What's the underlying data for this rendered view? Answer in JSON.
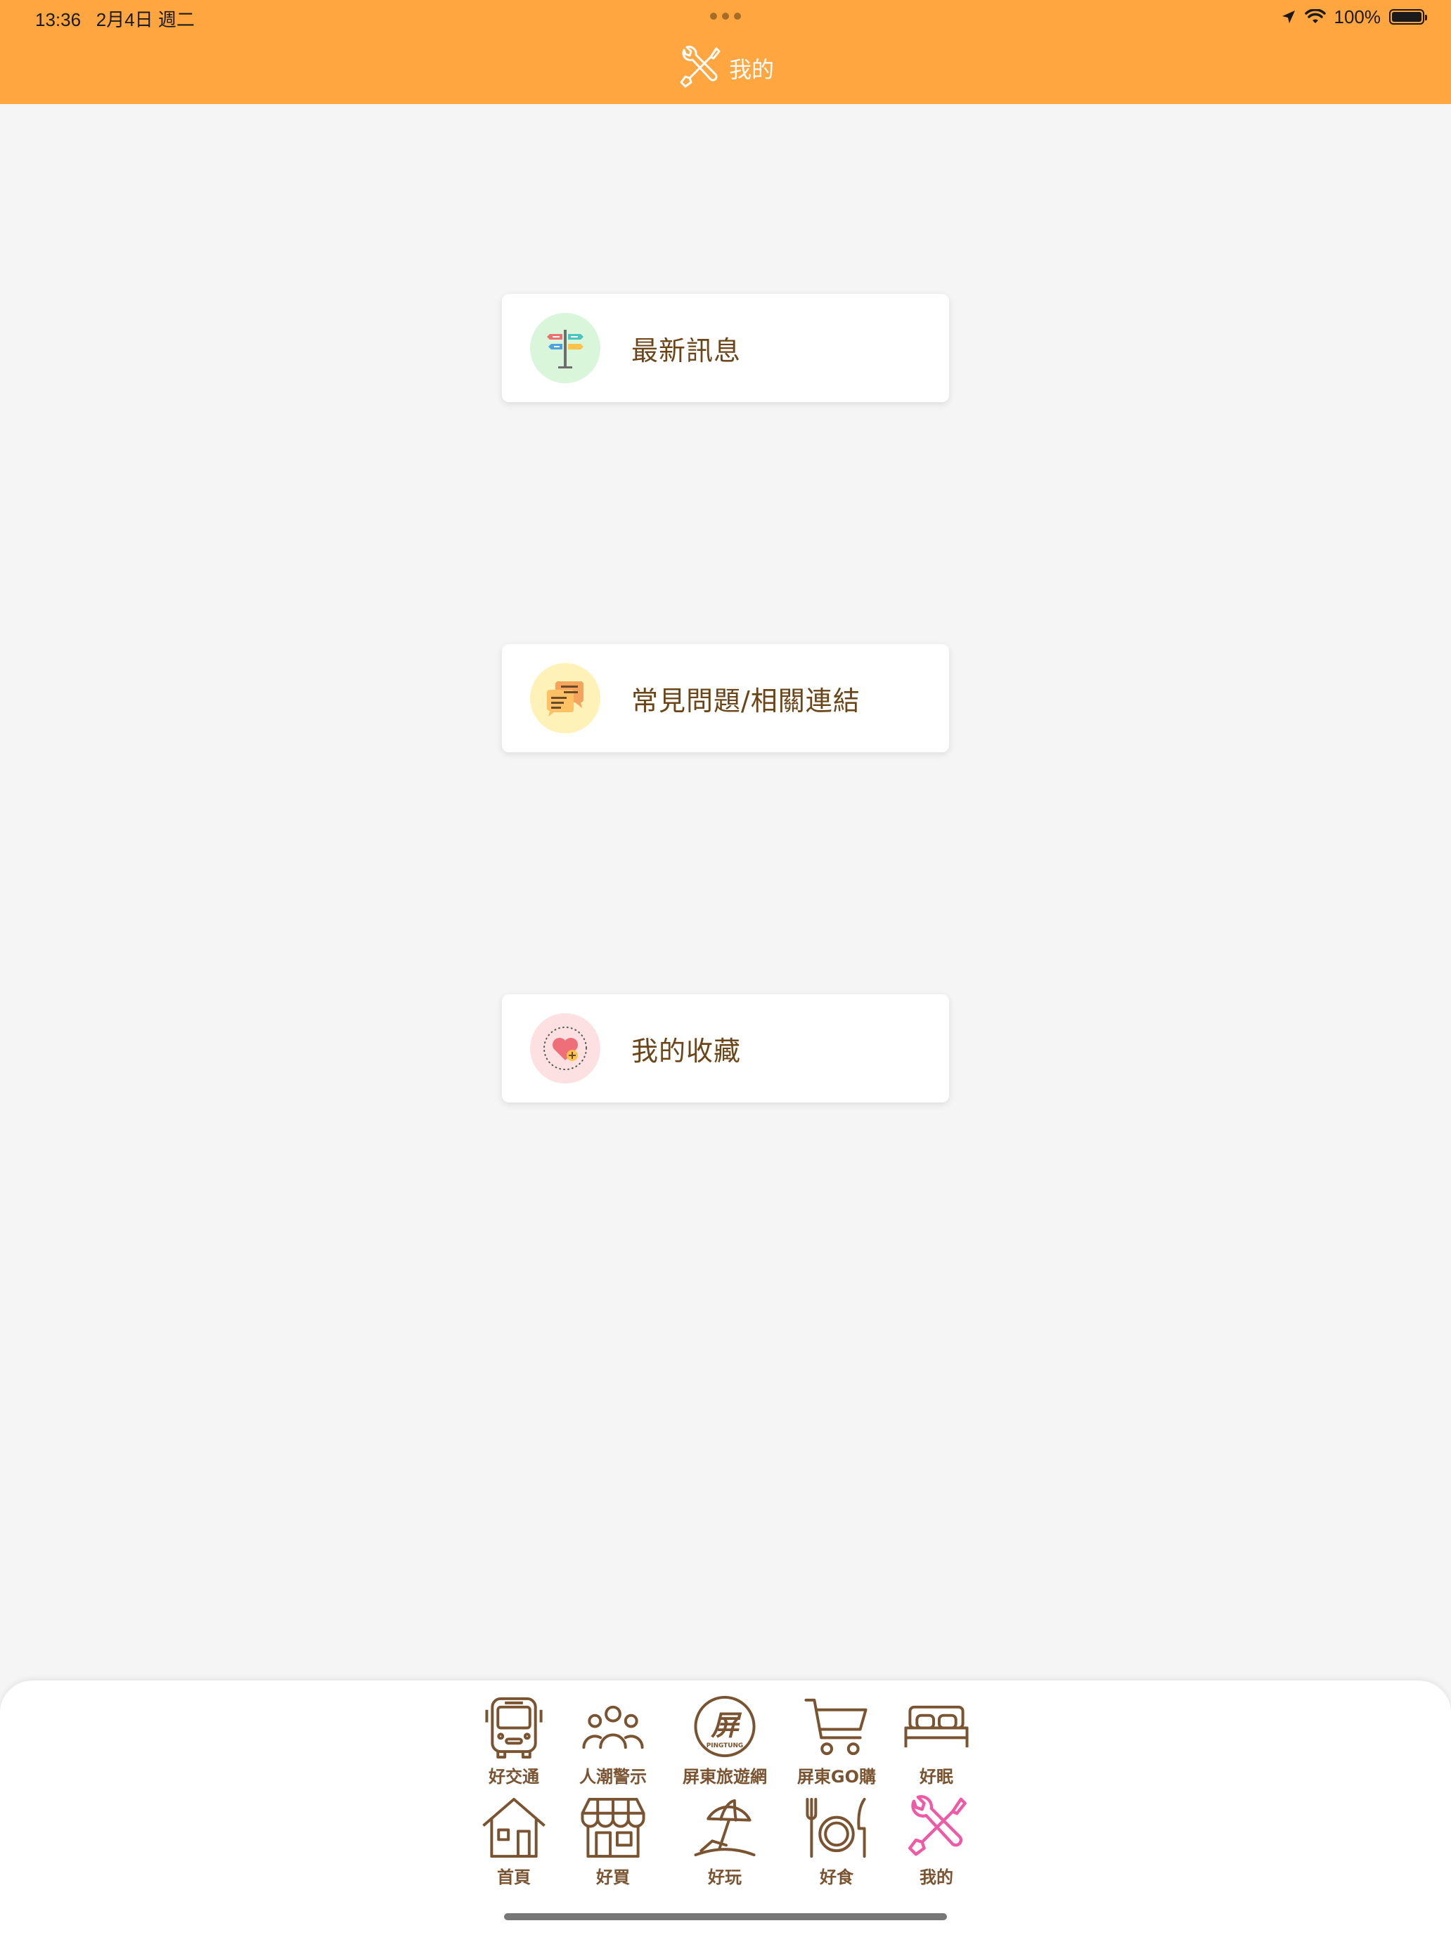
{
  "status_bar": {
    "time": "13:36",
    "date": "2月4日 週二",
    "battery": "100%"
  },
  "header": {
    "title": "我的",
    "icon": "tools-icon",
    "background": "#ffa640"
  },
  "menu": [
    {
      "label": "最新訊息",
      "icon": "signpost-icon",
      "icon_bg": "#d9f5da"
    },
    {
      "label": "常見問題/相關連結",
      "icon": "chat-bubbles-icon",
      "icon_bg": "#fff2b8"
    },
    {
      "label": "我的收藏",
      "icon": "heart-plus-icon",
      "icon_bg": "#fde0e2"
    }
  ],
  "tabbar": {
    "row1": [
      {
        "label": "好交通",
        "icon": "bus-icon"
      },
      {
        "label": "人潮警示",
        "icon": "crowd-icon"
      },
      {
        "label": "屏東旅遊網",
        "icon": "pingtung-logo-icon",
        "logo_text": "PINGTUNG"
      },
      {
        "label": "屏東GO購",
        "icon": "cart-icon"
      },
      {
        "label": "好眠",
        "icon": "bed-icon"
      }
    ],
    "row2": [
      {
        "label": "首頁",
        "icon": "house-icon"
      },
      {
        "label": "好買",
        "icon": "shop-icon"
      },
      {
        "label": "好玩",
        "icon": "beach-umbrella-icon"
      },
      {
        "label": "好食",
        "icon": "dining-icon"
      },
      {
        "label": "我的",
        "icon": "tools-icon",
        "active": true
      }
    ],
    "icon_color": "#7a5330",
    "active_icon_color": "#ee5aa5"
  }
}
